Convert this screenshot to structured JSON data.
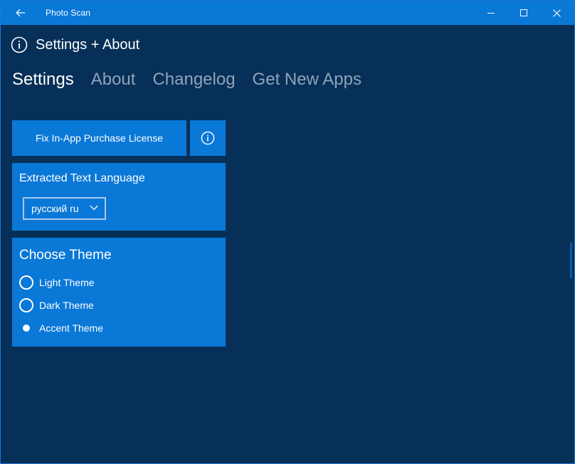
{
  "window": {
    "title": "Photo Scan",
    "accent_color": "#0a78d7",
    "background_color": "#063058"
  },
  "header": {
    "title": "Settings + About"
  },
  "tabs": [
    {
      "label": "Settings",
      "active": true
    },
    {
      "label": "About",
      "active": false
    },
    {
      "label": "Changelog",
      "active": false
    },
    {
      "label": "Get New Apps",
      "active": false
    }
  ],
  "settings": {
    "fix_license_label": "Fix In-App Purchase License",
    "language": {
      "title": "Extracted Text Language",
      "selected": "русский ru"
    },
    "theme": {
      "title": "Choose Theme",
      "options": [
        {
          "label": "Light Theme",
          "checked": false
        },
        {
          "label": "Dark Theme",
          "checked": false
        },
        {
          "label": "Accent Theme",
          "checked": true
        }
      ]
    }
  }
}
